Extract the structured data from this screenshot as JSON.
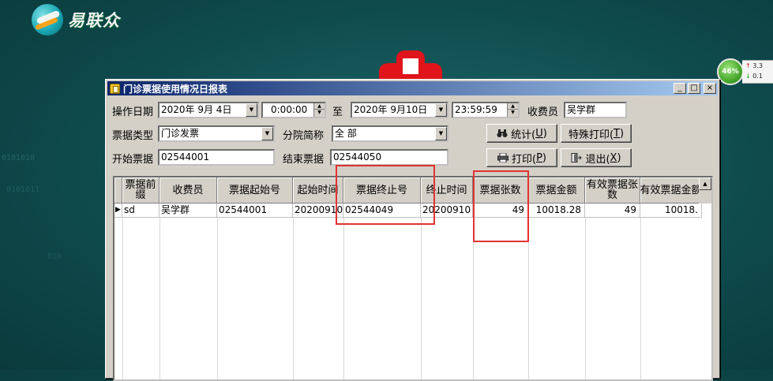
{
  "desktop": {
    "brand_name": "易联众",
    "cpu_percent": "46%",
    "net_up": "3.3",
    "net_down": "0.1",
    "bg_binary_1": "0101010",
    "bg_binary_2": "0101011",
    "bg_binary_3": "010"
  },
  "window": {
    "title": "门诊票据使用情况日报表",
    "minimize": "_",
    "maximize": "□",
    "close": "×"
  },
  "filters": {
    "date_label": "操作日期",
    "date_from": "2020年 9月 4日",
    "time_from": "0:00:00",
    "to_label": "至",
    "date_to": "2020年 9月10日",
    "time_to": "23:59:59",
    "cashier_label": "收费员",
    "cashier_value": "吴学群",
    "type_label": "票据类型",
    "type_value": "门诊发票",
    "branch_label": "分院简称",
    "branch_value": "全 部",
    "start_label": "开始票据",
    "start_value": "02544001",
    "end_label": "结束票据",
    "end_value": "02544050"
  },
  "buttons": {
    "stats": "统计(",
    "stats_key": "U",
    "special_print": "特殊打印(",
    "special_print_key": "T",
    "print": "打印(",
    "print_key": "P",
    "exit": "退出(",
    "exit_key": "X",
    "close_paren": ")"
  },
  "table": {
    "headers": [
      "票据前缀",
      "收费员",
      "票据起始号",
      "起始时间",
      "票据终止号",
      "终止时间",
      "票据张数",
      "票据金额",
      "有效票据张数",
      "有效票据金额"
    ],
    "rows": [
      [
        "sd",
        "吴学群",
        "02544001",
        "20200910",
        "02544049",
        "20200910",
        "49",
        "10018.28",
        "49",
        "10018."
      ]
    ]
  },
  "colors": {
    "highlight": "#e23232",
    "title_start": "#0a246a",
    "title_end": "#a6caf0"
  }
}
